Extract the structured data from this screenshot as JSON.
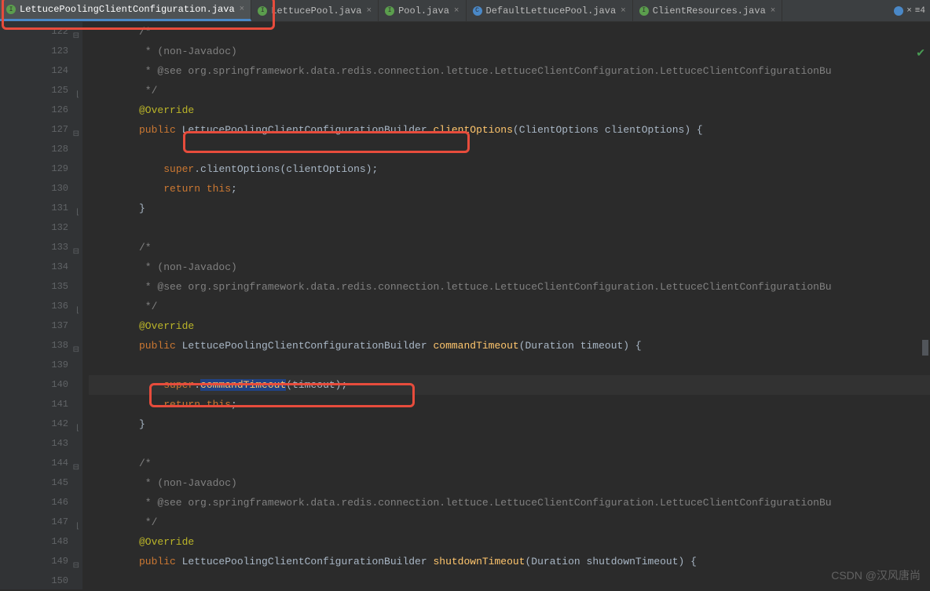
{
  "tabs": [
    {
      "label": "LettucePoolingClientConfiguration.java",
      "icon": "interface",
      "active": true
    },
    {
      "label": "LettucePool.java",
      "icon": "interface",
      "active": false
    },
    {
      "label": "Pool.java",
      "icon": "interface",
      "active": false
    },
    {
      "label": "DefaultLettucePool.java",
      "icon": "class",
      "active": false
    },
    {
      "label": "ClientResources.java",
      "icon": "interface",
      "active": false
    }
  ],
  "overflow": "≡4",
  "watermark": "CSDN @汉风唐尚",
  "lines": [
    {
      "num": "122",
      "mark": "open",
      "tokens": [
        {
          "t": "/*",
          "c": "comment"
        }
      ]
    },
    {
      "num": "123",
      "tokens": [
        {
          "t": " * (non-Javadoc)",
          "c": "comment"
        }
      ]
    },
    {
      "num": "124",
      "tokens": [
        {
          "t": " * @see org.springframework.data.redis.connection.lettuce.LettuceClientConfiguration.LettuceClientConfigurationBu",
          "c": "comment"
        }
      ]
    },
    {
      "num": "125",
      "mark": "close",
      "tokens": [
        {
          "t": " */",
          "c": "comment"
        }
      ]
    },
    {
      "num": "126",
      "tokens": [
        {
          "t": "@Override",
          "c": "annotation"
        }
      ]
    },
    {
      "num": "127",
      "override": true,
      "mark": "open",
      "tokens": [
        {
          "t": "public ",
          "c": "keyword"
        },
        {
          "t": "LettucePoolingClientConfigurationBuilder ",
          "c": "type"
        },
        {
          "t": "clientOptions",
          "c": "method"
        },
        {
          "t": "(ClientOptions clientOptions) {",
          "c": "param"
        }
      ]
    },
    {
      "num": "128",
      "tokens": [
        {
          "t": "",
          "c": ""
        }
      ]
    },
    {
      "num": "129",
      "indent": 1,
      "tokens": [
        {
          "t": "super",
          "c": "keyword"
        },
        {
          "t": ".clientOptions(clientOptions);",
          "c": "param"
        }
      ]
    },
    {
      "num": "130",
      "indent": 1,
      "tokens": [
        {
          "t": "return this",
          "c": "keyword"
        },
        {
          "t": ";",
          "c": "param"
        }
      ]
    },
    {
      "num": "131",
      "mark": "close",
      "tokens": [
        {
          "t": "}",
          "c": "param"
        }
      ]
    },
    {
      "num": "132",
      "tokens": [
        {
          "t": "",
          "c": ""
        }
      ]
    },
    {
      "num": "133",
      "mark": "open",
      "tokens": [
        {
          "t": "/*",
          "c": "comment"
        }
      ]
    },
    {
      "num": "134",
      "tokens": [
        {
          "t": " * (non-Javadoc)",
          "c": "comment"
        }
      ]
    },
    {
      "num": "135",
      "tokens": [
        {
          "t": " * @see org.springframework.data.redis.connection.lettuce.LettuceClientConfiguration.LettuceClientConfigurationBu",
          "c": "comment"
        }
      ]
    },
    {
      "num": "136",
      "mark": "close",
      "tokens": [
        {
          "t": " */",
          "c": "comment"
        }
      ]
    },
    {
      "num": "137",
      "tokens": [
        {
          "t": "@Override",
          "c": "annotation"
        }
      ]
    },
    {
      "num": "138",
      "override": true,
      "mark": "open",
      "tokens": [
        {
          "t": "public ",
          "c": "keyword"
        },
        {
          "t": "LettucePoolingClientConfigurationBuilder ",
          "c": "type"
        },
        {
          "t": "commandTimeout",
          "c": "method"
        },
        {
          "t": "(Duration timeout) {",
          "c": "param"
        }
      ]
    },
    {
      "num": "139",
      "tokens": [
        {
          "t": "",
          "c": ""
        }
      ]
    },
    {
      "num": "140",
      "highlighted": true,
      "indent": 1,
      "tokens": [
        {
          "t": "super",
          "c": "keyword"
        },
        {
          "t": ".",
          "c": "param"
        },
        {
          "t": "commandTimeout",
          "c": "method",
          "sel": true
        },
        {
          "t": "(timeout);",
          "c": "param"
        }
      ]
    },
    {
      "num": "141",
      "indent": 1,
      "tokens": [
        {
          "t": "return this",
          "c": "keyword"
        },
        {
          "t": ";",
          "c": "param"
        }
      ]
    },
    {
      "num": "142",
      "mark": "close",
      "tokens": [
        {
          "t": "}",
          "c": "param"
        }
      ]
    },
    {
      "num": "143",
      "tokens": [
        {
          "t": "",
          "c": ""
        }
      ]
    },
    {
      "num": "144",
      "mark": "open",
      "tokens": [
        {
          "t": "/*",
          "c": "comment"
        }
      ]
    },
    {
      "num": "145",
      "tokens": [
        {
          "t": " * (non-Javadoc)",
          "c": "comment"
        }
      ]
    },
    {
      "num": "146",
      "tokens": [
        {
          "t": " * @see org.springframework.data.redis.connection.lettuce.LettuceClientConfiguration.LettuceClientConfigurationBu",
          "c": "comment"
        }
      ]
    },
    {
      "num": "147",
      "mark": "close",
      "tokens": [
        {
          "t": " */",
          "c": "comment"
        }
      ]
    },
    {
      "num": "148",
      "tokens": [
        {
          "t": "@Override",
          "c": "annotation"
        }
      ]
    },
    {
      "num": "149",
      "override": true,
      "mark": "open",
      "tokens": [
        {
          "t": "public ",
          "c": "keyword"
        },
        {
          "t": "LettucePoolingClientConfigurationBuilder ",
          "c": "type"
        },
        {
          "t": "shutdownTimeout",
          "c": "method"
        },
        {
          "t": "(Duration shutdownTimeout) {",
          "c": "param"
        }
      ]
    },
    {
      "num": "150",
      "tokens": [
        {
          "t": "",
          "c": ""
        }
      ]
    }
  ]
}
